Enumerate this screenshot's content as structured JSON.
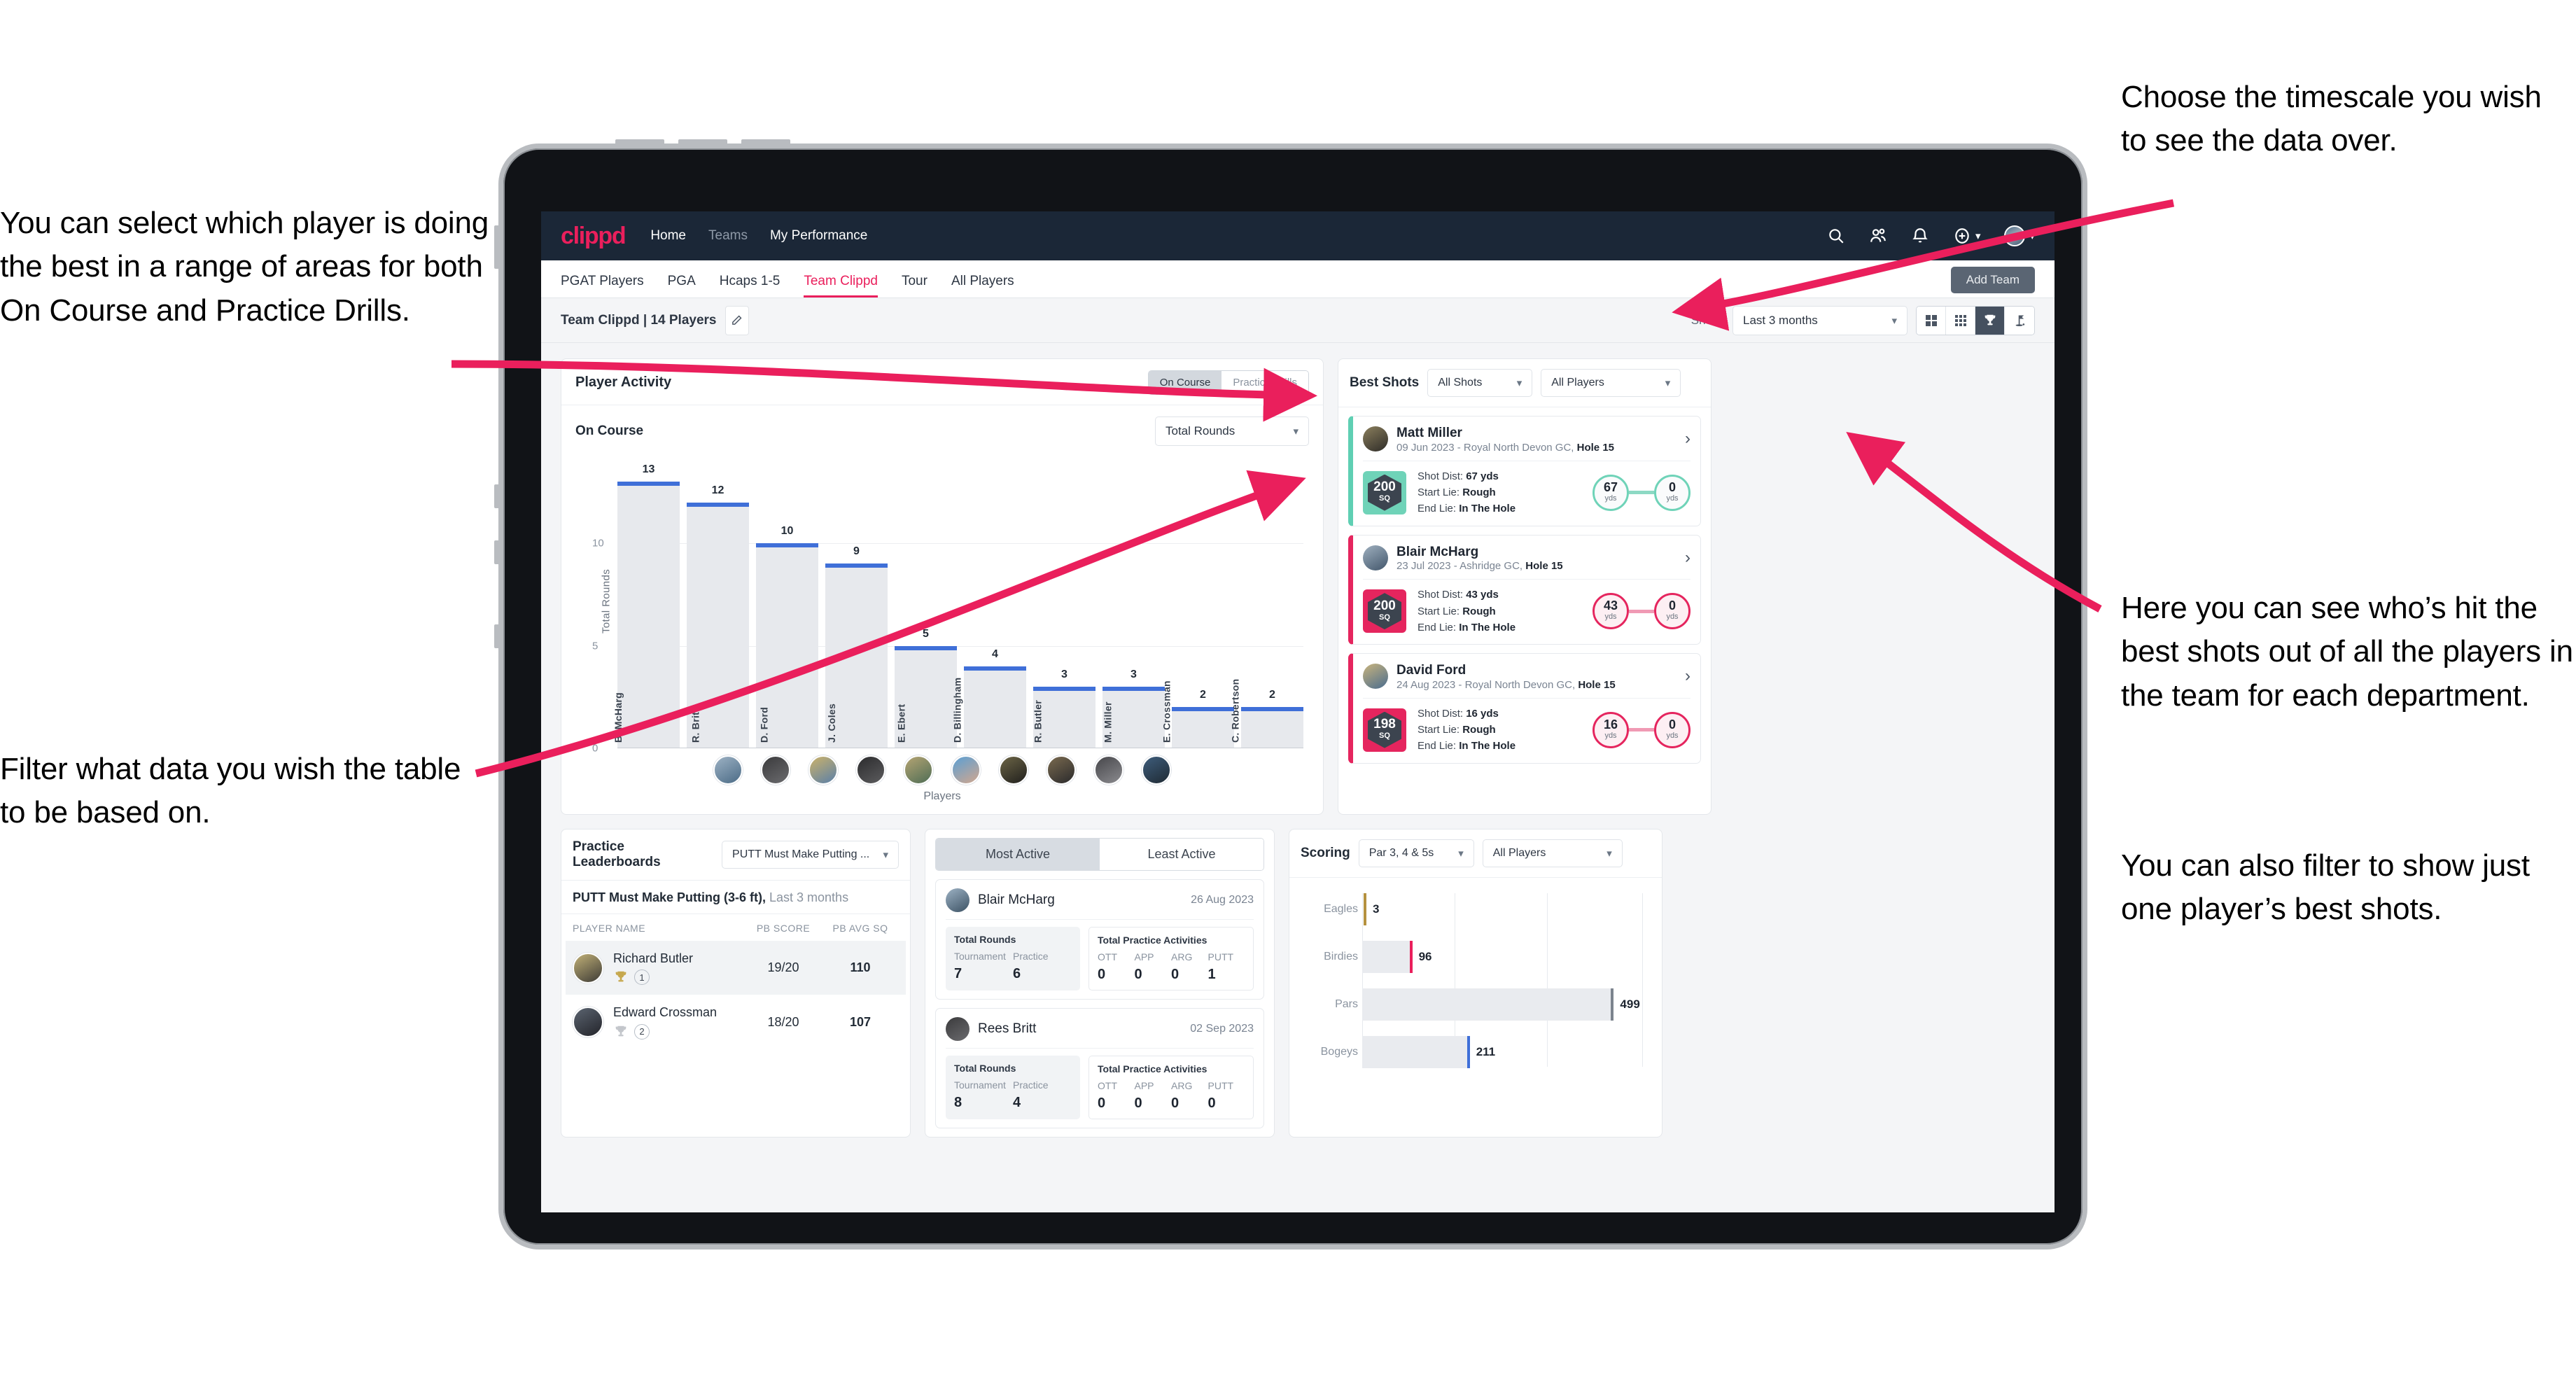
{
  "annotations": {
    "player_select": "You can select which player is doing the best in a range of areas for both On Course and Practice Drills.",
    "filter_table": "Filter what data you wish the table to be based on.",
    "timescale": "Choose the timescale you wish to see the data over.",
    "best_shots": "Here you can see who’s hit the best shots out of all the players in the team for each department.",
    "filter_player": "You can also filter to show just one player’s best shots."
  },
  "navbar": {
    "logo": "clippd",
    "links": [
      {
        "label": "Home",
        "active": true
      },
      {
        "label": "Teams",
        "active": false
      },
      {
        "label": "My Performance",
        "active": false
      }
    ],
    "icons": [
      "search-icon",
      "people-icon",
      "bell-icon",
      "plus-circle-icon",
      "avatar"
    ]
  },
  "tabbar": {
    "tabs": [
      {
        "label": "PGAT Players",
        "state": "normal"
      },
      {
        "label": "PGA",
        "state": "normal"
      },
      {
        "label": "Hcaps 1-5",
        "state": "normal"
      },
      {
        "label": "Team Clippd",
        "state": "active"
      },
      {
        "label": "Tour",
        "state": "normal"
      },
      {
        "label": "All Players",
        "state": "normal"
      }
    ],
    "add_team_label": "Add Team"
  },
  "toolbar": {
    "team_label": "Team Clippd | 14 Players",
    "edit_icon": "pencil-icon",
    "show_label": "Show:",
    "timescale_value": "Last 3 months",
    "view_toggles": [
      {
        "name": "grid-2x2-icon",
        "active": false
      },
      {
        "name": "grid-3x3-icon",
        "active": false
      },
      {
        "name": "trophy-icon",
        "active": true
      },
      {
        "name": "golf-flag-icon",
        "active": false
      }
    ]
  },
  "player_activity": {
    "title": "Player Activity",
    "segments": [
      {
        "label": "On Course",
        "active": true
      },
      {
        "label": "Practice Drills",
        "active": false
      }
    ],
    "sub_title": "On Course",
    "metric_value": "Total Rounds"
  },
  "chart_data": [
    {
      "type": "bar",
      "title": "Player Activity — On Course",
      "categories": [
        "B. McHarg",
        "R. Britt",
        "D. Ford",
        "J. Coles",
        "E. Ebert",
        "D. Billingham",
        "R. Butler",
        "M. Miller",
        "E. Crossman",
        "C. Robertson"
      ],
      "values": [
        13,
        12,
        10,
        9,
        5,
        4,
        3,
        3,
        2,
        2
      ],
      "xlabel": "Players",
      "ylabel": "Total Rounds",
      "yticks": [
        0,
        5,
        10
      ],
      "ylim": [
        0,
        14
      ],
      "grid": true,
      "bar_color": "#e7e9ed",
      "cap_color": "#3f6fd8"
    },
    {
      "type": "bar",
      "orientation": "horizontal",
      "title": "Scoring",
      "categories": [
        "Eagles",
        "Birdies",
        "Pars",
        "Bogeys"
      ],
      "values": [
        3,
        96,
        499,
        211
      ],
      "cap_colors": [
        "#b5913f",
        "#ea1f5c",
        "#7c848e",
        "#3f6fd8"
      ],
      "xlabel": "",
      "ylabel": "",
      "xlim": [
        0,
        560
      ],
      "grid": true
    }
  ],
  "best_shots": {
    "title": "Best Shots",
    "filter_shots": "All Shots",
    "filter_players": "All Players",
    "shots": [
      {
        "player": "Matt Miller",
        "meta_date": "09 Jun 2023 - Royal North Devon GC,",
        "meta_hole": "Hole 15",
        "sq": "200",
        "sq_unit": "SQ",
        "shot_dist_label": "Shot Dist:",
        "shot_dist": "67 yds",
        "start_lie_label": "Start Lie:",
        "start_lie": "Rough",
        "end_lie_label": "End Lie:",
        "end_lie": "In The Hole",
        "from_value": "67",
        "from_unit": "yds",
        "to_value": "0",
        "to_unit": "yds",
        "accent": "teal"
      },
      {
        "player": "Blair McHarg",
        "meta_date": "23 Jul 2023 - Ashridge GC,",
        "meta_hole": "Hole 15",
        "sq": "200",
        "sq_unit": "SQ",
        "shot_dist_label": "Shot Dist:",
        "shot_dist": "43 yds",
        "start_lie_label": "Start Lie:",
        "start_lie": "Rough",
        "end_lie_label": "End Lie:",
        "end_lie": "In The Hole",
        "from_value": "43",
        "from_unit": "yds",
        "to_value": "0",
        "to_unit": "yds",
        "accent": "pink"
      },
      {
        "player": "David Ford",
        "meta_date": "24 Aug 2023 - Royal North Devon GC,",
        "meta_hole": "Hole 15",
        "sq": "198",
        "sq_unit": "SQ",
        "shot_dist_label": "Shot Dist:",
        "shot_dist": "16 yds",
        "start_lie_label": "Start Lie:",
        "start_lie": "Rough",
        "end_lie_label": "End Lie:",
        "end_lie": "In The Hole",
        "from_value": "16",
        "from_unit": "yds",
        "to_value": "0",
        "to_unit": "yds",
        "accent": "pink"
      }
    ]
  },
  "practice_leaderboards": {
    "title": "Practice Leaderboards",
    "drill_value": "PUTT Must Make Putting ...",
    "sub_bold": "PUTT Must Make Putting (3-6 ft),",
    "sub_light": " Last 3 months",
    "columns": [
      "PLAYER NAME",
      "PB SCORE",
      "PB AVG SQ"
    ],
    "rows": [
      {
        "name": "Richard Butler",
        "rank": "1",
        "trophy": "gold",
        "pb_score": "19/20",
        "pb_avg_sq": "110",
        "highlight": true
      },
      {
        "name": "Edward Crossman",
        "rank": "2",
        "trophy": "silver",
        "pb_score": "18/20",
        "pb_avg_sq": "107",
        "highlight": false
      }
    ]
  },
  "activity_panel": {
    "tabs": [
      {
        "label": "Most Active",
        "active": true
      },
      {
        "label": "Least Active",
        "active": false
      }
    ],
    "items": [
      {
        "name": "Blair McHarg",
        "date": "26 Aug 2023",
        "rounds_title": "Total Rounds",
        "rounds_keys": [
          "Tournament",
          "Practice"
        ],
        "rounds_values": [
          "7",
          "6"
        ],
        "practice_title": "Total Practice Activities",
        "practice_keys": [
          "OTT",
          "APP",
          "ARG",
          "PUTT"
        ],
        "practice_values": [
          "0",
          "0",
          "0",
          "1"
        ]
      },
      {
        "name": "Rees Britt",
        "date": "02 Sep 2023",
        "rounds_title": "Total Rounds",
        "rounds_keys": [
          "Tournament",
          "Practice"
        ],
        "rounds_values": [
          "8",
          "4"
        ],
        "practice_title": "Total Practice Activities",
        "practice_keys": [
          "OTT",
          "APP",
          "ARG",
          "PUTT"
        ],
        "practice_values": [
          "0",
          "0",
          "0",
          "0"
        ]
      }
    ]
  },
  "scoring": {
    "title": "Scoring",
    "filter_par": "Par 3, 4 & 5s",
    "filter_players": "All Players"
  }
}
